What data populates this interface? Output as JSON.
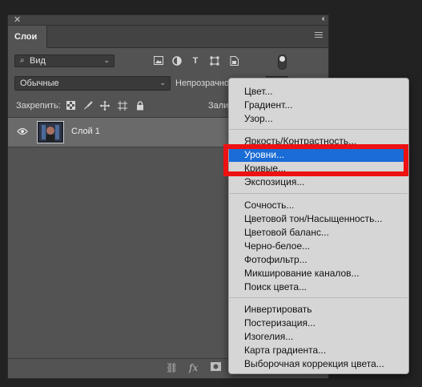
{
  "panel": {
    "close_glyph": "✕",
    "collapse_glyph": "‹‹",
    "tab_label": "Слои"
  },
  "filter": {
    "value": "Вид",
    "icon": "search-icon"
  },
  "blend": {
    "value": "Обычные",
    "opacity_label": "Непрозрачно"
  },
  "lock": {
    "label": "Закрепить:",
    "fill_label": "Зали"
  },
  "layer": {
    "name": "Слой 1"
  },
  "bottom": {
    "link_glyph": "⛓",
    "fx_label": "fx"
  },
  "menu": {
    "items": [
      "Цвет...",
      "Градиент...",
      "Узор...",
      "Яркость/Контрастность...",
      "Уровни...",
      "Кривые...",
      "Экспозиция...",
      "Сочность...",
      "Цветовой тон/Насыщенность...",
      "Цветовой баланс...",
      "Черно-белое...",
      "Фотофильтр...",
      "Микширование каналов...",
      "Поиск цвета...",
      "Инвертировать",
      "Постеризация...",
      "Изогелия...",
      "Карта градиента...",
      "Выборочная коррекция цвета..."
    ],
    "highlighted": "Уровни...",
    "highlight_color": "#1a6cd6",
    "annotation_color": "#ee1111"
  }
}
